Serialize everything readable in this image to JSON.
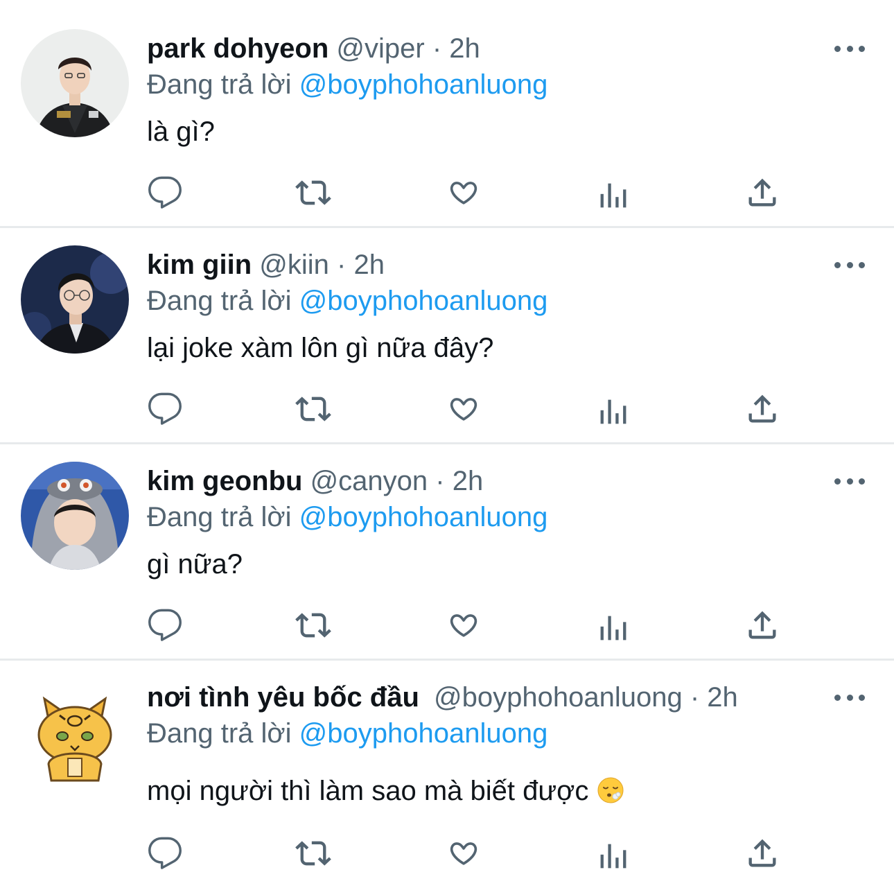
{
  "colors": {
    "text": "#0f1419",
    "secondary": "#536471",
    "link": "#1d9bf0",
    "divider": "#e7eaec"
  },
  "icons": {
    "more": "more-horizontal-icon",
    "reply": "reply-bubble-icon",
    "retweet": "retweet-icon",
    "like": "heart-icon",
    "views": "bar-chart-icon",
    "share": "share-icon"
  },
  "tweets": [
    {
      "name": "park dohyeon",
      "handle": "@viper",
      "separator": "·",
      "time": "2h",
      "reply_prefix": "Đang trả lời",
      "reply_to": "@boyphohoanluong",
      "text": "là gì?"
    },
    {
      "name": "kim giin",
      "handle": "@kiin",
      "separator": "·",
      "time": "2h",
      "reply_prefix": "Đang trả lời",
      "reply_to": "@boyphohoanluong",
      "text": "lại joke xàm lôn gì nữa đây?"
    },
    {
      "name": "kim geonbu",
      "handle": "@canyon",
      "separator": "·",
      "time": "2h",
      "reply_prefix": "Đang trả lời",
      "reply_to": "@boyphohoanluong",
      "text": "gì nữa?"
    },
    {
      "name": "nơi tình yêu bốc đầu",
      "handle": "@boyphohoanluong",
      "separator": "·",
      "time": "2h",
      "reply_prefix": "Đang trả lời",
      "reply_to": "@boyphohoanluong",
      "text": "mọi người thì làm sao mà biết được",
      "emoji": "😮‍💨"
    }
  ]
}
